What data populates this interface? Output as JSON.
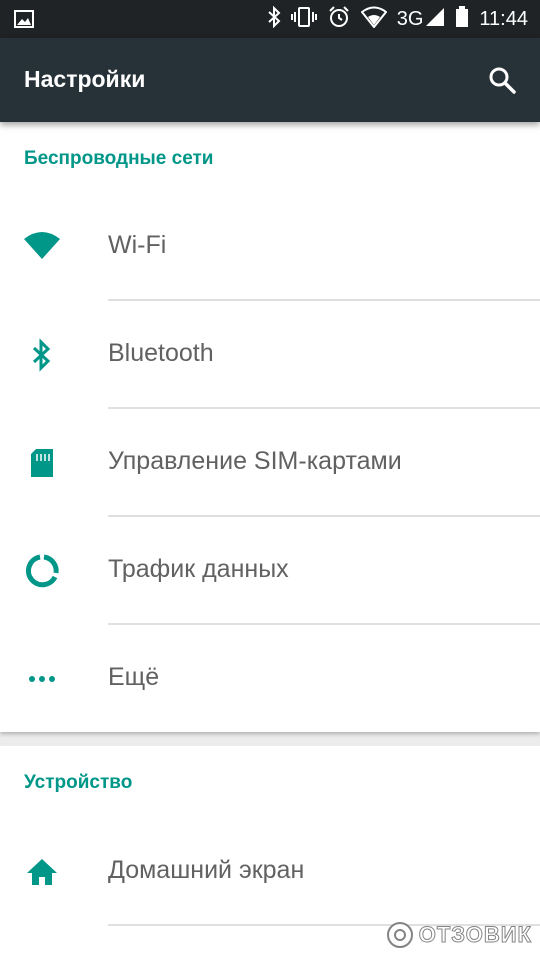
{
  "status_bar": {
    "network": "3G",
    "time": "11:44",
    "icons": [
      "image-notification-icon",
      "bluetooth-icon",
      "vibrate-icon",
      "alarm-icon",
      "wifi-signal-icon",
      "cell-signal-icon",
      "battery-icon"
    ]
  },
  "toolbar": {
    "title": "Настройки",
    "search_icon": "search-icon"
  },
  "colors": {
    "accent": "#009688",
    "toolbar": "#263238",
    "statusbar": "#1f2326"
  },
  "sections": [
    {
      "header": "Беспроводные сети",
      "items": [
        {
          "label": "Wi-Fi",
          "icon": "wifi-icon"
        },
        {
          "label": "Bluetooth",
          "icon": "bluetooth-icon"
        },
        {
          "label": "Управление SIM-картами",
          "icon": "sim-card-icon"
        },
        {
          "label": "Трафик данных",
          "icon": "data-usage-icon"
        },
        {
          "label": "Ещё",
          "icon": "more-dots-icon"
        }
      ]
    },
    {
      "header": "Устройство",
      "items": [
        {
          "label": "Домашний экран",
          "icon": "home-icon"
        }
      ]
    }
  ],
  "watermark": "ОТЗОВИК"
}
